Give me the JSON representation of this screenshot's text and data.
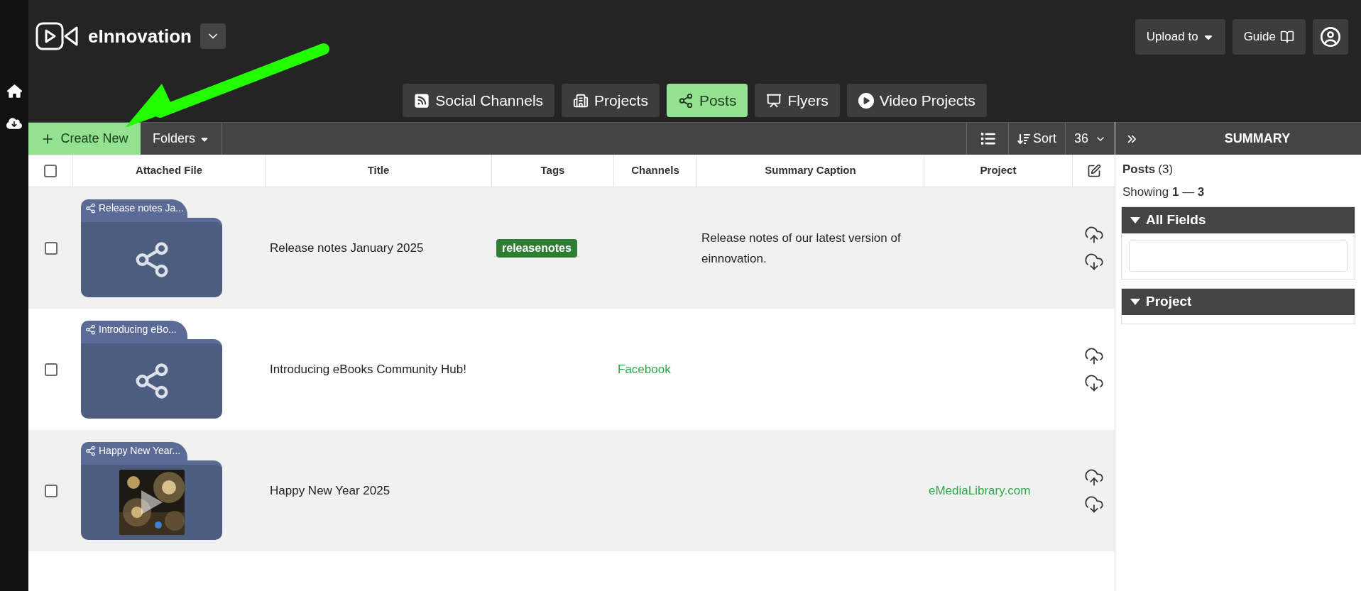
{
  "app": {
    "logo": "eInnovation"
  },
  "header_buttons": [
    {
      "kind": "dropdown",
      "label": "Upload to"
    },
    {
      "kind": "guide",
      "label": "Guide"
    },
    {
      "kind": "account"
    }
  ],
  "tabs": [
    {
      "kind": "rss",
      "label": "Social Channels",
      "selected": false
    },
    {
      "kind": "building",
      "label": "Projects",
      "selected": false
    },
    {
      "kind": "share",
      "label": "Posts",
      "selected": true
    },
    {
      "kind": "easel",
      "label": "Flyers",
      "selected": false
    },
    {
      "kind": "play",
      "label": "Video Projects",
      "selected": false
    }
  ],
  "toolbar": {
    "create": "Create New",
    "folders": "Folders",
    "sort": "Sort",
    "per_page": "36"
  },
  "table": {
    "select_all": {
      "checked": false
    },
    "columns": [
      "Attached File",
      "Title",
      "Tags",
      "Channels",
      "Summary Caption",
      "Project"
    ],
    "rows": [
      {
        "checked": false,
        "attachment": {
          "kind": "share",
          "label": "Release notes Ja..."
        },
        "title": "Release notes January 2025",
        "tags": [
          {
            "label": "releasenotes",
            "color": "#2e7d32"
          }
        ],
        "caption": "Release notes of our latest version of einnovation."
      },
      {
        "checked": false,
        "attachment": {
          "kind": "share",
          "label": "Introducing eBo..."
        },
        "title": "Introducing eBooks Community Hub!",
        "channel": "Facebook"
      },
      {
        "checked": false,
        "attachment": {
          "kind": "picture",
          "label": "Happy New Year..."
        },
        "title": "Happy New Year 2025",
        "project": "eMediaLibrary.com"
      }
    ]
  },
  "summary_panel": {
    "title": "SUMMARY",
    "posts_label": "Posts",
    "posts_count": "(3)",
    "showing": "Showing **1** — **3**",
    "sections": [
      {
        "kind": "search",
        "title": "All Fields",
        "expanded": true
      },
      {
        "kind": "list",
        "title": "Project",
        "expanded": true
      }
    ]
  }
}
